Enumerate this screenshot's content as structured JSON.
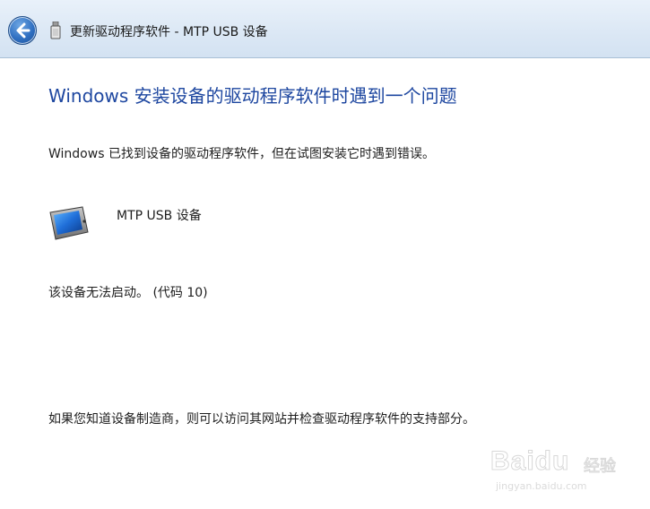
{
  "window": {
    "title": "更新驱动程序软件 - MTP USB 设备"
  },
  "icons": {
    "back": "back-arrow-icon",
    "usb": "usb-device-icon",
    "device": "portable-device-icon"
  },
  "content": {
    "heading": "Windows 安装设备的驱动程序软件时遇到一个问题",
    "message": "Windows 已找到设备的驱动程序软件，但在试图安装它时遇到错误。",
    "device_name": "MTP USB 设备",
    "status": "该设备无法启动。 (代码 10)",
    "advice": "如果您知道设备制造商，则可以访问其网站并检查驱动程序软件的支持部分。"
  },
  "watermark": {
    "brand": "Baidu",
    "sub": "经验",
    "url": "jingyan.baidu.com"
  },
  "colors": {
    "heading": "#1e47a0",
    "titlebar": "#dce8f5",
    "back_button": "#2f6fc1"
  }
}
